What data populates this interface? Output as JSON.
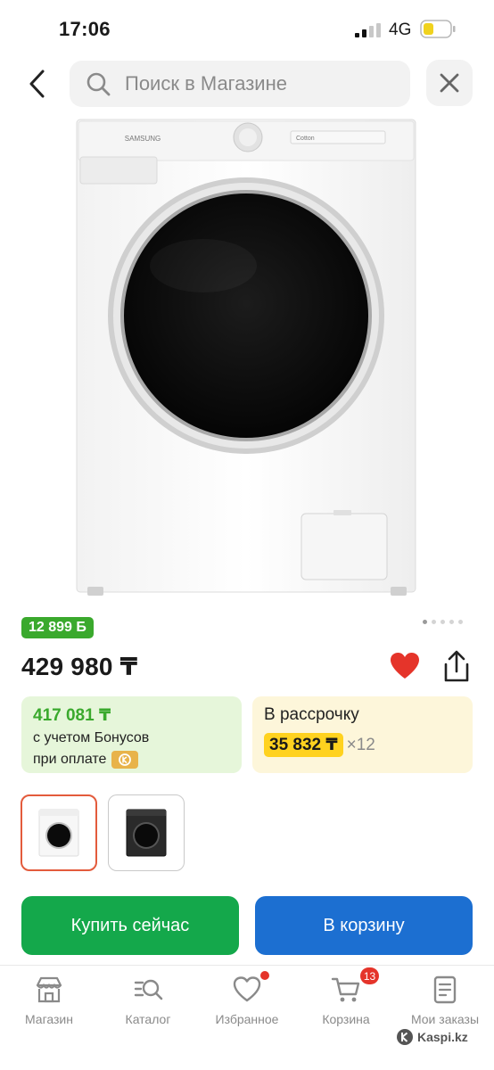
{
  "status_bar": {
    "time": "17:06",
    "network": "4G"
  },
  "search": {
    "placeholder": "Поиск в Магазине"
  },
  "product": {
    "image_alt": "Samsung washing machine",
    "brand_mark": "SAMSUNG",
    "display_text": "Cotton",
    "bonus_badge": "12 899 Б",
    "price": "429 980 ₸",
    "bonus_card": {
      "amount": "417 081 ₸",
      "line1": "с учетом Бонусов",
      "line2": "при оплате"
    },
    "installment_card": {
      "title": "В рассрочку",
      "monthly": "35 832 ₸",
      "multiplier": "×12"
    },
    "image_pager": {
      "count": 5,
      "active_index": 0
    }
  },
  "actions": {
    "buy_now": "Купить сейчас",
    "add_to_cart": "В корзину"
  },
  "tab_bar": {
    "items": [
      {
        "label": "Магазин",
        "icon": "shop-icon"
      },
      {
        "label": "Каталог",
        "icon": "catalog-icon"
      },
      {
        "label": "Избранное",
        "icon": "heart-icon",
        "has_dot": true
      },
      {
        "label": "Корзина",
        "icon": "cart-icon",
        "badge": "13"
      },
      {
        "label": "Мои заказы",
        "icon": "orders-icon"
      }
    ]
  },
  "watermark": "Kaspi.kz",
  "colors": {
    "green": "#3aa92d",
    "buy_button": "#14a84b",
    "cart_button": "#1c6fd1",
    "favorite": "#e5342a",
    "installment_highlight": "#ffd21f"
  }
}
